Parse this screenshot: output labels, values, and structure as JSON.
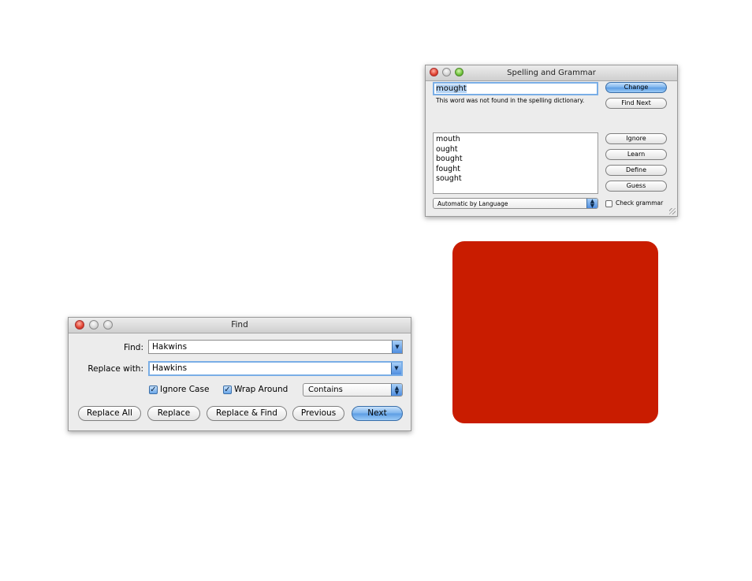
{
  "spelling": {
    "title": "Spelling and Grammar",
    "word": "mought",
    "message": "This word was not found in the spelling dictionary.",
    "suggestions": [
      "mouth",
      "ought",
      "bought",
      "fought",
      "sought"
    ],
    "buttons": {
      "change": "Change",
      "find_next": "Find Next",
      "ignore": "Ignore",
      "learn": "Learn",
      "define": "Define",
      "guess": "Guess"
    },
    "language": "Automatic by Language",
    "check_grammar": "Check grammar"
  },
  "find": {
    "title": "Find",
    "find_label": "Find:",
    "find_value": "Hakwins",
    "replace_label": "Replace with:",
    "replace_value": "Hawkins",
    "ignore_case": "Ignore Case",
    "wrap_around": "Wrap Around",
    "match_mode": "Contains",
    "buttons": {
      "replace_all": "Replace All",
      "replace": "Replace",
      "replace_find": "Replace & Find",
      "previous": "Previous",
      "next": "Next"
    }
  },
  "colors": {
    "panel_red": "#c91c00",
    "accent_blue": "#5b9ce3"
  }
}
